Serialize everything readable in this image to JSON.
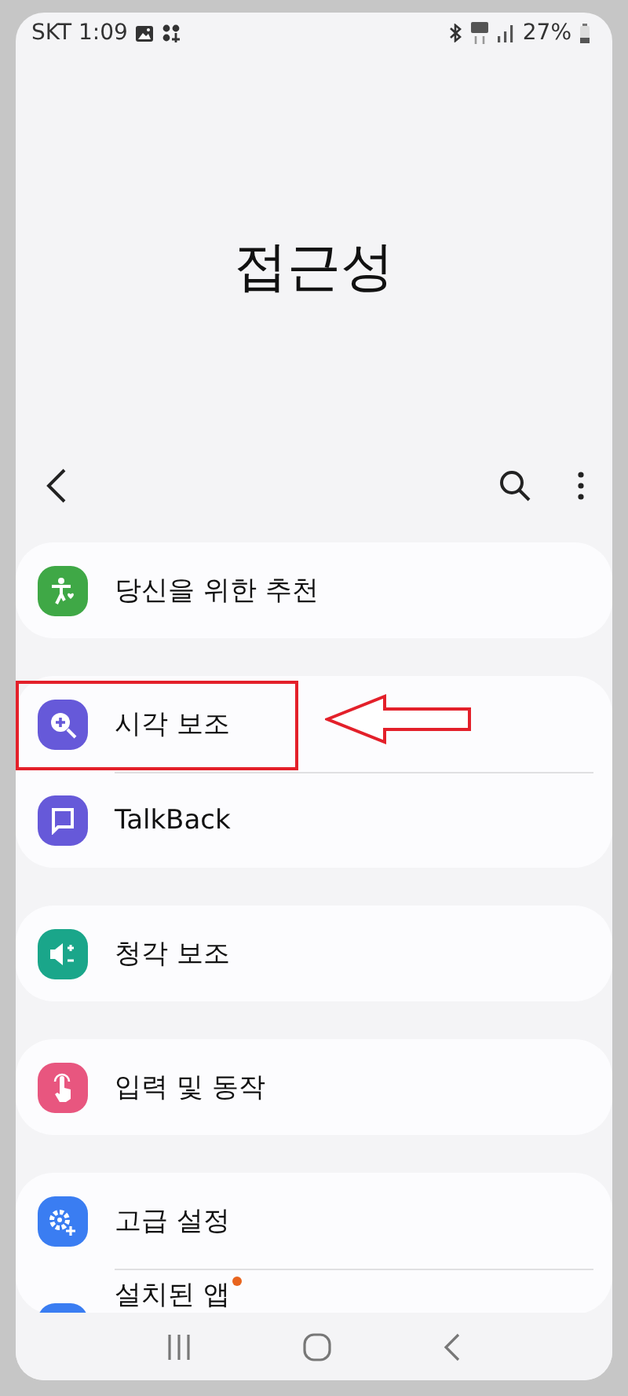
{
  "status_bar": {
    "carrier_time": "SKT 1:09",
    "battery_text": "27%"
  },
  "title": "접근성",
  "groups": [
    {
      "items": [
        {
          "label": "당신을 위한 추천",
          "color": "#3fa846",
          "highlighted": false,
          "new_badge": false
        }
      ]
    },
    {
      "items": [
        {
          "label": "시각 보조",
          "color": "#6659d9",
          "highlighted": true,
          "new_badge": false
        },
        {
          "label": "TalkBack",
          "color": "#6659d9",
          "highlighted": false,
          "new_badge": false
        }
      ]
    },
    {
      "items": [
        {
          "label": "청각 보조",
          "color": "#1aa68a",
          "highlighted": false,
          "new_badge": false
        }
      ]
    },
    {
      "items": [
        {
          "label": "입력 및 동작",
          "color": "#e8567f",
          "highlighted": false,
          "new_badge": false
        }
      ]
    },
    {
      "items": [
        {
          "label": "고급 설정",
          "color": "#3a7df2",
          "highlighted": false,
          "new_badge": false
        },
        {
          "label": "설치된 앱",
          "color": "#3a7df2",
          "highlighted": false,
          "new_badge": true
        }
      ]
    }
  ]
}
